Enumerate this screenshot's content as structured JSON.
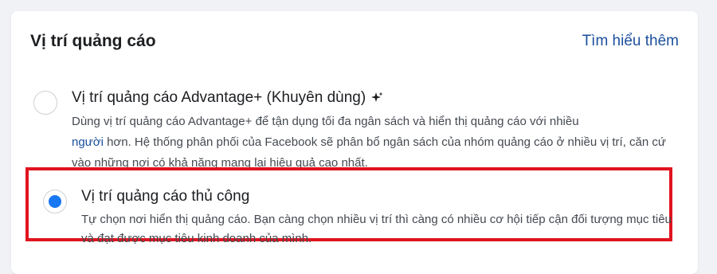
{
  "section": {
    "title": "Vị trí quảng cáo",
    "learn_more": "Tìm hiểu thêm"
  },
  "options": [
    {
      "title": "Vị trí quảng cáo Advantage+ (Khuyên dùng)",
      "icon": "sparkle-icon",
      "selected": false,
      "desc_pre": "Dùng vị trí quảng cáo Advantage+ để tận dụng tối đa ngân sách và hiển thị quảng cáo với nhiều",
      "desc_link": "người",
      "desc_post": " hơn. Hệ thống phân phối của Facebook sẽ phân bổ ngân sách của nhóm quảng cáo ở nhiều vị trí, căn cứ vào những nơi có khả năng mang lại hiệu quả cao nhất."
    },
    {
      "title": "Vị trí quảng cáo thủ công",
      "selected": true,
      "desc": "Tự chọn nơi hiển thị quảng cáo. Bạn càng chọn nhiều vị trí thì càng có nhiều cơ hội tiếp cận đối tượng mục tiêu và đạt được mục tiêu kinh doanh của mình."
    }
  ],
  "colors": {
    "accent": "#1877f2",
    "link": "#1b4f9b",
    "highlight_border": "#e0141f"
  }
}
